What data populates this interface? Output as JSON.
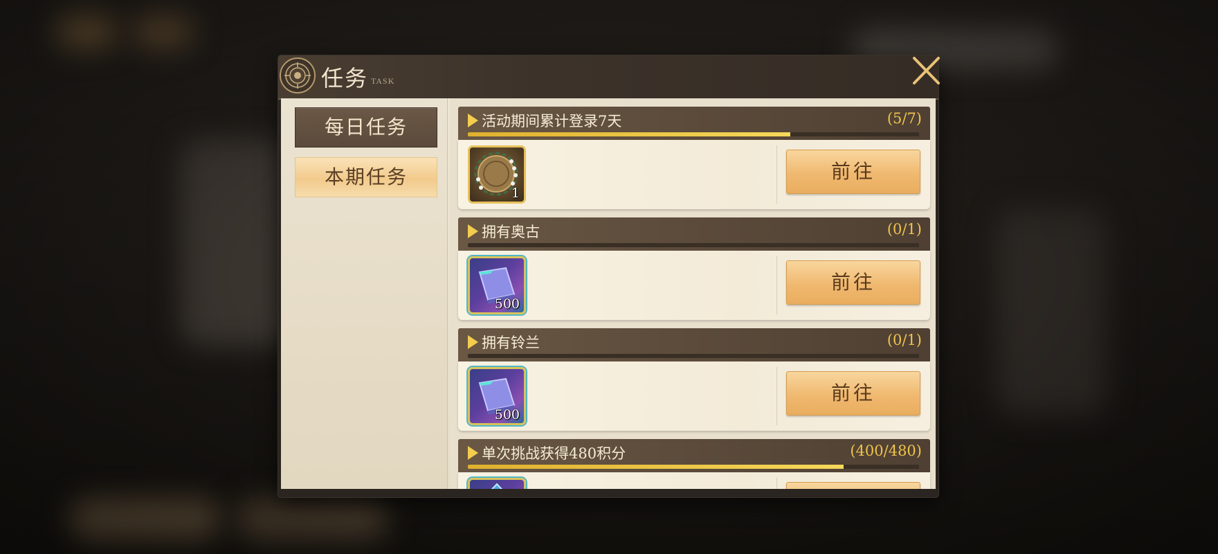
{
  "window": {
    "title": "任务",
    "subtitle": "TASK",
    "close_icon": "close-icon"
  },
  "sidebar": {
    "tabs": [
      {
        "label": "每日任务",
        "selected": true
      },
      {
        "label": "本期任务",
        "selected": false
      }
    ]
  },
  "tasks": [
    {
      "title": "活动期间累计登录7天",
      "count": "(5/7)",
      "progress": 0.714,
      "reward_icon": "gold-wreath-medal-icon",
      "reward_qty": "1",
      "button": "前往"
    },
    {
      "title": "拥有奥古",
      "count": "(0/1)",
      "progress": 0,
      "reward_icon": "purple-crystal-ingot-icon",
      "reward_qty": "500",
      "button": "前往"
    },
    {
      "title": "拥有铃兰",
      "count": "(0/1)",
      "progress": 0,
      "reward_icon": "purple-crystal-ingot-icon",
      "reward_qty": "500",
      "button": "前往"
    },
    {
      "title": "单次挑战获得480积分",
      "count": "(400/480)",
      "progress": 0.833,
      "reward_icon": "blue-crystal-icon",
      "reward_qty": "",
      "button": ""
    }
  ],
  "colors": {
    "accent_gold": "#f0c44c",
    "progress_fill": "#f6d85a",
    "button": "#f0b970",
    "header": "#5e4d3c"
  }
}
